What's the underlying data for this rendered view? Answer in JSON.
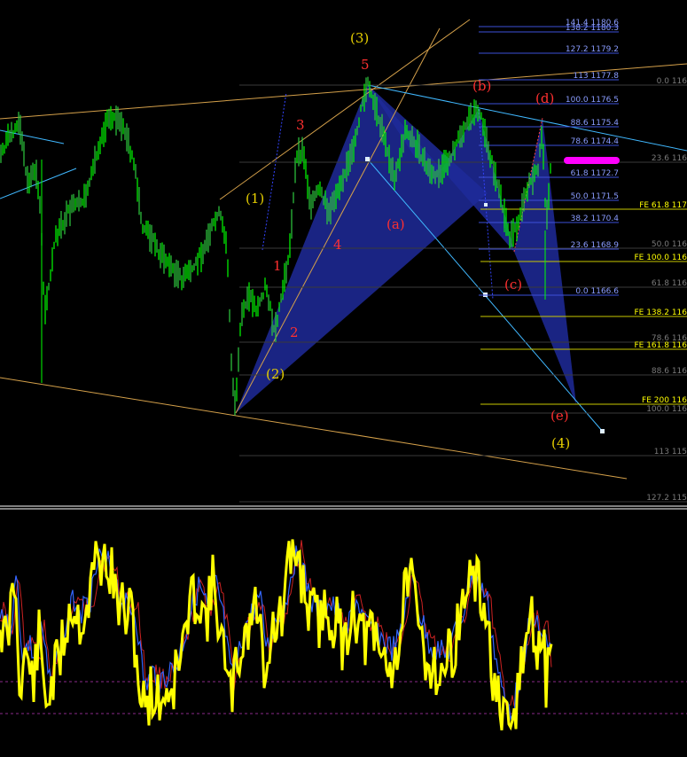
{
  "chart_data": [
    {
      "type": "line",
      "panel": "price",
      "colors": {
        "up": "#00ff00",
        "down": "#33cc33",
        "harmonic_fill": "#1f2a9a",
        "marker": "#ff00ff"
      },
      "elliott_labels": {
        "major": [
          "(1)",
          "(2)",
          "(3)",
          "(4)"
        ],
        "minor": [
          "1",
          "2",
          "3",
          "4",
          "5"
        ],
        "abc": [
          "(a)",
          "(b)",
          "(c)",
          "(d)",
          "(e)"
        ]
      },
      "fib_retracement_levels": [
        {
          "label": "141.4 1180.6"
        },
        {
          "label": "138.2 1180.3"
        },
        {
          "label": "127.2 1179.2"
        },
        {
          "label": "113 1177.8"
        },
        {
          "label": "100.0 1176.5"
        },
        {
          "label": "88.6 1175.4"
        },
        {
          "label": "78.6 1174.4"
        },
        {
          "label": "61.8 1172.7"
        },
        {
          "label": "50.0 1171.5"
        },
        {
          "label": "38.2 1170.4"
        },
        {
          "label": "23.6 1168.9"
        },
        {
          "label": "0.0 1166.6"
        }
      ],
      "fib_grey_levels": [
        "0.0 116",
        "23.6 116",
        "50.0 116",
        "61.8 116",
        "78.6 116",
        "88.6 116",
        "100.0 116",
        "113 115",
        "127.2 115"
      ],
      "fib_expansion_levels": [
        "FE 61.8 117",
        "FE 100.0 116",
        "FE 138.2 116",
        "FE 161.8 116",
        "FE 200 116"
      ]
    },
    {
      "type": "line",
      "panel": "oscillator",
      "series": [
        {
          "color": "#ffff00"
        },
        {
          "color": "#3366ff"
        },
        {
          "color": "#cc2222"
        }
      ],
      "levels": [
        20,
        80
      ]
    }
  ]
}
